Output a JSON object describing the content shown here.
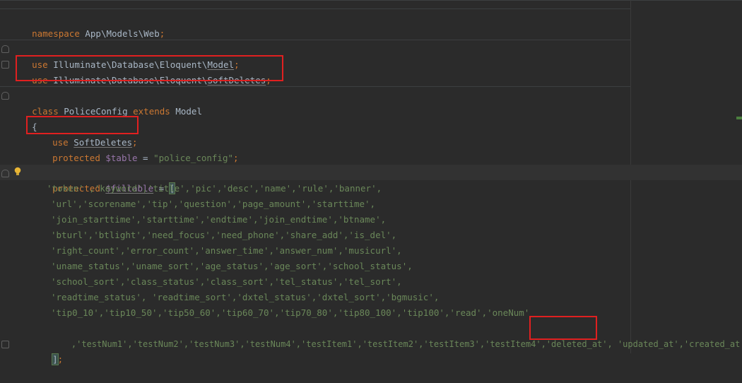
{
  "code": {
    "namespace": {
      "keyword": "namespace",
      "path": "App\\Models\\Web",
      "end": ";"
    },
    "use1": {
      "keyword": "use",
      "path": "Illuminate\\Database\\Eloquent\\",
      "cls": "Model",
      "end": ";"
    },
    "use2": {
      "keyword": "use",
      "path": "Illuminate\\Database\\Eloquent\\",
      "cls": "SoftDeletes",
      "end": ";"
    },
    "class_decl": {
      "kw_class": "class",
      "name": "PoliceConfig",
      "kw_extends": "extends",
      "parent": "Model"
    },
    "open_brace": "{",
    "use_trait": {
      "keyword": "use",
      "name": "SoftDeletes",
      "end": ";"
    },
    "table_prop": {
      "keyword": "protected",
      "var": "$table",
      "op": " = ",
      "value": "\"police_config\"",
      "end": ";"
    },
    "fillable_prop": {
      "keyword": "protected",
      "var": "$fillable",
      "op": " = ",
      "bracket": "["
    },
    "fillable_lines": [
      "'token' ,'keyword','title','pic','desc','name','rule','banner',",
      "'url','scorename','tip','question','page_amount','starttime',",
      "'join_starttime','starttime','endtime','join_endtime','btname',",
      "'bturl','btlight','need_focus','need_phone','share_add','is_del',",
      "'right_count','error_count','answer_time','answer_num','musicurl',",
      "'uname_status','uname_sort','age_status','age_sort','school_status',",
      "'school_sort','class_status','class_sort','tel_status','tel_sort',",
      "'readtime_status', 'readtime_sort','dxtel_status','dxtel_sort','bgmusic',",
      "'tip0_10','tip10_50','tip50_60','tip60_70','tip70_80','tip80_100','tip100','read','oneNum'"
    ],
    "last_line": {
      "prefix": ",'testNum1','testNum2','testNum3','testNum4','testItem1','testItem2','testItem3','testItem4',",
      "deleted": "'deleted_at'",
      "rest": "'updated_at','created_at'"
    },
    "close": {
      "bracket": "]",
      "end": ";"
    }
  }
}
